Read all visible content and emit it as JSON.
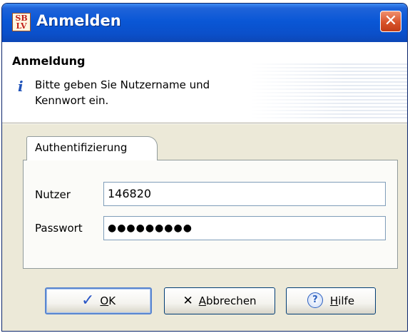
{
  "window": {
    "title": "Anmelden",
    "icon_name": "sbv-app-icon",
    "close_symbol": "✕"
  },
  "header": {
    "title": "Anmeldung",
    "message_line1": "Bitte geben Sie Nutzername und",
    "message_line2": "Kennwort ein.",
    "info_symbol": "i"
  },
  "tab": {
    "label": "Authentifizierung"
  },
  "form": {
    "user_label": "Nutzer",
    "user_value": "146820",
    "password_label": "Passwort",
    "password_mask": "●●●●●●●●●"
  },
  "buttons": {
    "ok_accel": "O",
    "ok_rest": "K",
    "cancel_accel": "A",
    "cancel_rest": "bbrechen",
    "help_accel": "H",
    "help_rest": "ilfe"
  },
  "colors": {
    "titlebar": "#0a57d6",
    "dialog_bg": "#ece9d8",
    "close_button": "#d8532b",
    "ok_check": "#2a56c6"
  }
}
